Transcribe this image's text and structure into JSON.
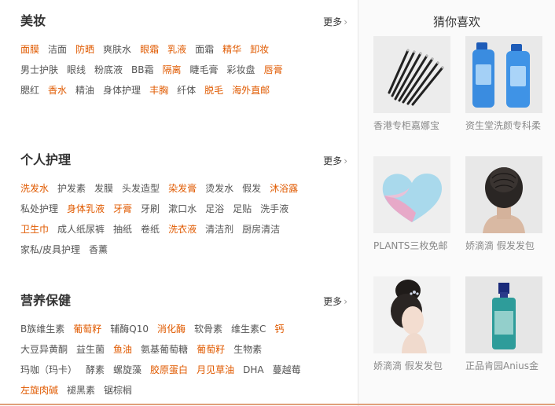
{
  "sections": [
    {
      "title": "美妆",
      "more": "更多",
      "rows": [
        [
          {
            "t": "面膜",
            "hot": true
          },
          {
            "t": "洁面",
            "hot": false
          },
          {
            "t": "防晒",
            "hot": true
          },
          {
            "t": "爽肤水",
            "hot": false
          },
          {
            "t": "眼霜",
            "hot": true
          },
          {
            "t": "乳液",
            "hot": true
          },
          {
            "t": "面霜",
            "hot": false
          },
          {
            "t": "精华",
            "hot": true
          },
          {
            "t": "卸妆",
            "hot": true
          }
        ],
        [
          {
            "t": "男士护肤",
            "hot": false
          },
          {
            "t": "眼线",
            "hot": false
          },
          {
            "t": "粉底液",
            "hot": false
          },
          {
            "t": "BB霜",
            "hot": false
          },
          {
            "t": "隔离",
            "hot": true
          },
          {
            "t": "睫毛膏",
            "hot": false
          },
          {
            "t": "彩妆盘",
            "hot": false
          },
          {
            "t": "唇膏",
            "hot": true
          }
        ],
        [
          {
            "t": "腮红",
            "hot": false
          },
          {
            "t": "香水",
            "hot": true
          },
          {
            "t": "精油",
            "hot": false
          },
          {
            "t": "身体护理",
            "hot": false
          },
          {
            "t": "丰胸",
            "hot": true
          },
          {
            "t": "纤体",
            "hot": false
          },
          {
            "t": "脱毛",
            "hot": true
          },
          {
            "t": "海外直邮",
            "hot": true
          }
        ]
      ]
    },
    {
      "title": "个人护理",
      "more": "更多",
      "rows": [
        [
          {
            "t": "洗发水",
            "hot": true
          },
          {
            "t": "护发素",
            "hot": false
          },
          {
            "t": "发膜",
            "hot": false
          },
          {
            "t": "头发造型",
            "hot": false
          },
          {
            "t": "染发膏",
            "hot": true
          },
          {
            "t": "烫发水",
            "hot": false
          },
          {
            "t": "假发",
            "hot": false
          },
          {
            "t": "沐浴露",
            "hot": true
          }
        ],
        [
          {
            "t": "私处护理",
            "hot": false
          },
          {
            "t": "身体乳液",
            "hot": true
          },
          {
            "t": "牙膏",
            "hot": true
          },
          {
            "t": "牙刷",
            "hot": false
          },
          {
            "t": "漱口水",
            "hot": false
          },
          {
            "t": "足浴",
            "hot": false
          },
          {
            "t": "足贴",
            "hot": false
          },
          {
            "t": "洗手液",
            "hot": false
          }
        ],
        [
          {
            "t": "卫生巾",
            "hot": true
          },
          {
            "t": "成人纸尿裤",
            "hot": false
          },
          {
            "t": "抽纸",
            "hot": false
          },
          {
            "t": "卷纸",
            "hot": false
          },
          {
            "t": "洗衣液",
            "hot": true
          },
          {
            "t": "清洁剂",
            "hot": false
          },
          {
            "t": "厨房清洁",
            "hot": false
          }
        ],
        [
          {
            "t": "家私/皮具护理",
            "hot": false
          },
          {
            "t": "香薰",
            "hot": false
          }
        ]
      ]
    },
    {
      "title": "营养保健",
      "more": "更多",
      "rows": [
        [
          {
            "t": "B族维生素",
            "hot": false
          },
          {
            "t": "葡萄籽",
            "hot": true
          },
          {
            "t": "辅酶Q10",
            "hot": false
          },
          {
            "t": "消化酶",
            "hot": true
          },
          {
            "t": "软骨素",
            "hot": false
          },
          {
            "t": "维生素C",
            "hot": false
          },
          {
            "t": "钙",
            "hot": true
          }
        ],
        [
          {
            "t": "大豆异黄酮",
            "hot": false
          },
          {
            "t": "益生菌",
            "hot": false
          },
          {
            "t": "鱼油",
            "hot": true
          },
          {
            "t": "氨基葡萄糖",
            "hot": false
          },
          {
            "t": "葡萄籽",
            "hot": true
          },
          {
            "t": "生物素",
            "hot": false
          }
        ],
        [
          {
            "t": "玛咖（玛卡）",
            "hot": false
          },
          {
            "t": "酵素",
            "hot": false
          },
          {
            "t": "螺旋藻",
            "hot": false
          },
          {
            "t": "胶原蛋白",
            "hot": true
          },
          {
            "t": "月见草油",
            "hot": true
          },
          {
            "t": "DHA",
            "hot": false
          },
          {
            "t": "蔓越莓",
            "hot": false
          }
        ],
        [
          {
            "t": "左旋肉碱",
            "hot": true
          },
          {
            "t": "褪黑素",
            "hot": false
          },
          {
            "t": "锯棕榈",
            "hot": false
          }
        ]
      ]
    }
  ],
  "guess": {
    "title": "猜你喜欢",
    "products": [
      {
        "name": "香港专柜嘉娜宝",
        "icon": "eyeliner-pencils-image"
      },
      {
        "name": "资生堂洗颜专科柔",
        "icon": "cleanser-bottles-image"
      },
      {
        "name": "PLANTS三枚免邮",
        "icon": "heart-bath-bomb-image"
      },
      {
        "name": "娇滴滴 假发发包",
        "icon": "hair-bun-back-image"
      },
      {
        "name": "娇滴滴 假发发包",
        "icon": "bride-updo-image"
      },
      {
        "name": "正品肯园Anius金",
        "icon": "oil-bottle-image"
      }
    ]
  },
  "colors": {
    "hot": "#e05a00",
    "normal": "#555555",
    "accent_line": "#e0a07a"
  }
}
